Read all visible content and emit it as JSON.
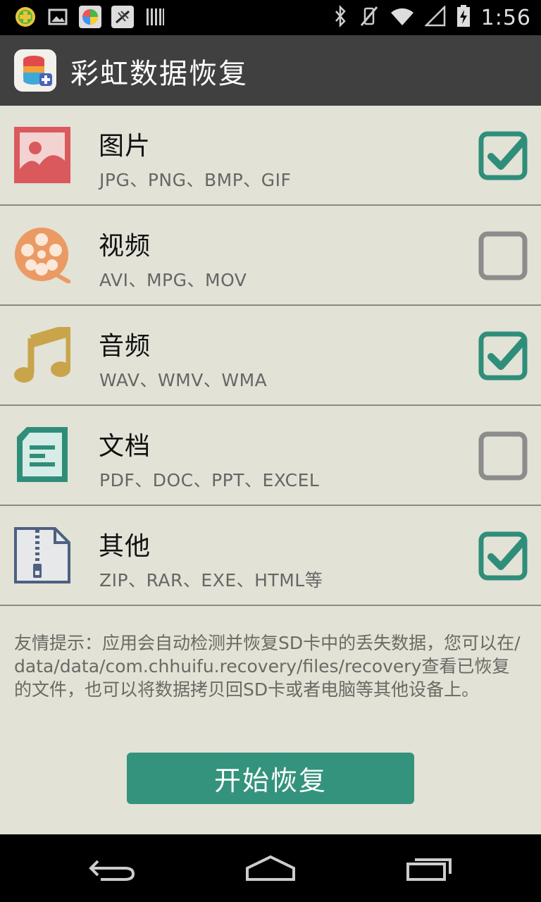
{
  "status_bar": {
    "time": "1:56",
    "left_icons": [
      "app-360-icon",
      "gallery-icon",
      "app-colorful-icon",
      "muted-app-icon",
      "barcode-icon"
    ],
    "right_icons": [
      "bluetooth-icon",
      "vibrate-off-icon",
      "wifi-icon",
      "signal-icon",
      "battery-charging-icon"
    ]
  },
  "app_bar": {
    "title": "彩虹数据恢复"
  },
  "categories": [
    {
      "title": "图片",
      "formats": "JPG、PNG、BMP、GIF",
      "checked": true,
      "icon": "picture-icon",
      "color": "#d9595c"
    },
    {
      "title": "视频",
      "formats": "AVI、MPG、MOV",
      "checked": false,
      "icon": "film-reel-icon",
      "color": "#eb9a63"
    },
    {
      "title": "音频",
      "formats": "WAV、WMV、WMA",
      "checked": true,
      "icon": "music-note-icon",
      "color": "#c9a44b"
    },
    {
      "title": "文档",
      "formats": "PDF、DOC、PPT、EXCEL",
      "checked": false,
      "icon": "document-icon",
      "color": "#2f8e7a"
    },
    {
      "title": "其他",
      "formats": "ZIP、RAR、EXE、HTML等",
      "checked": true,
      "icon": "zip-file-icon",
      "color": "#4e6080"
    }
  ],
  "tip": "友情提示：应用会自动检测并恢复SD卡中的丢失数据，您可以在/data/data/com.chhuifu.recovery/files/recovery查看已恢复的文件，也可以将数据拷贝回SD卡或者电脑等其他设备上。",
  "start_button": {
    "label": "开始恢复"
  },
  "colors": {
    "accent": "#34937c",
    "checkbox_on": "#2f8e7a",
    "checkbox_off": "#8c8c8c"
  }
}
